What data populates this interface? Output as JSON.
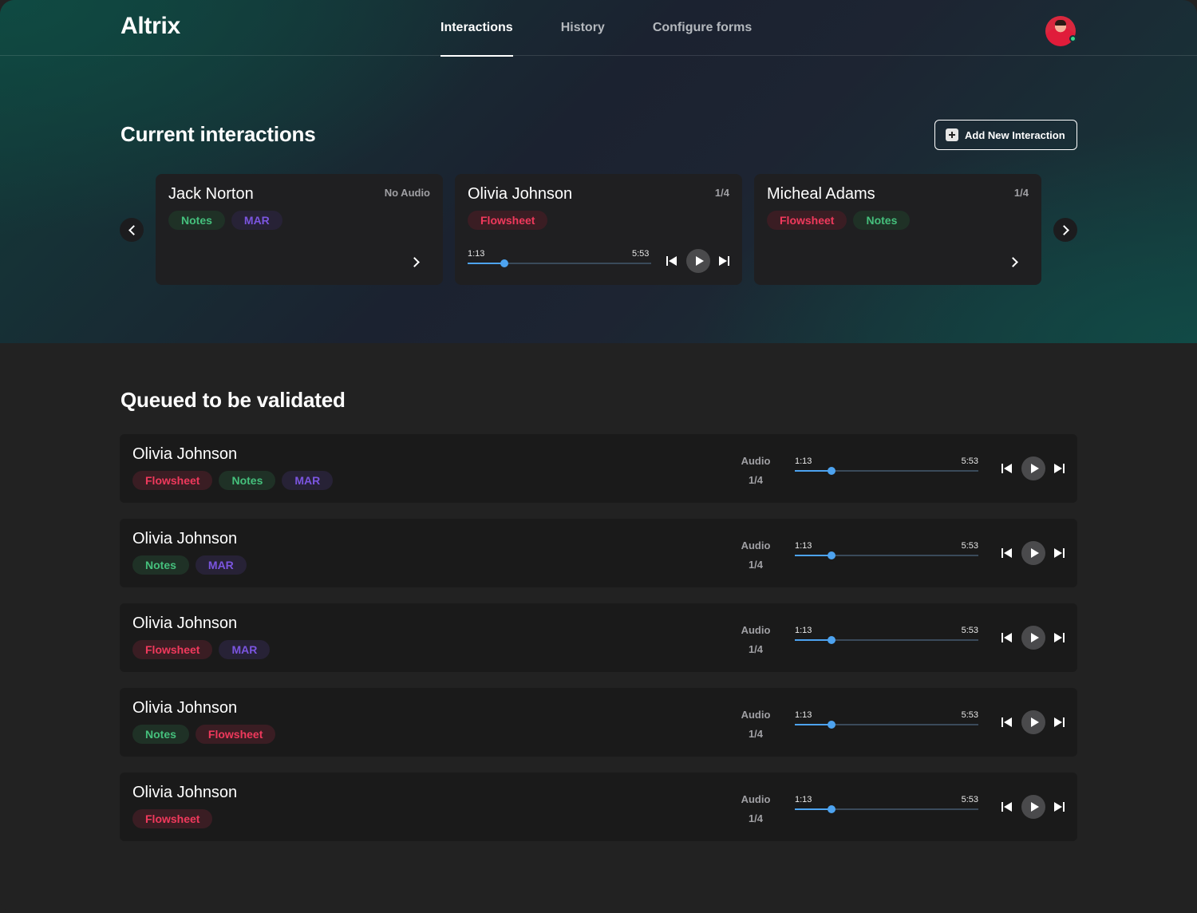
{
  "app": {
    "name": "Altrix"
  },
  "nav": {
    "items": [
      {
        "label": "Interactions",
        "active": true
      },
      {
        "label": "History",
        "active": false
      },
      {
        "label": "Configure forms",
        "active": false
      }
    ]
  },
  "user": {
    "avatar": "avatar",
    "status": "online"
  },
  "current": {
    "title": "Current interactions",
    "add_button": "Add New Interaction",
    "cards": [
      {
        "name": "Jack Norton",
        "meta": "No Audio",
        "tags": [
          "Notes",
          "MAR"
        ],
        "has_player": false
      },
      {
        "name": "Olivia Johnson",
        "meta": "1/4",
        "tags": [
          "Flowsheet"
        ],
        "has_player": true,
        "player": {
          "current": "1:13",
          "total": "5:53",
          "progress": 0.2
        }
      },
      {
        "name": "Micheal Adams",
        "meta": "1/4",
        "tags": [
          "Flowsheet",
          "Notes"
        ],
        "has_player": false
      }
    ]
  },
  "queue": {
    "title": "Queued to be validated",
    "rows": [
      {
        "name": "Olivia Johnson",
        "tags": [
          "Flowsheet",
          "Notes",
          "MAR"
        ],
        "audio_label": "Audio",
        "audio_count": "1/4",
        "current": "1:13",
        "total": "5:53",
        "progress": 0.2
      },
      {
        "name": "Olivia Johnson",
        "tags": [
          "Notes",
          "MAR"
        ],
        "audio_label": "Audio",
        "audio_count": "1/4",
        "current": "1:13",
        "total": "5:53",
        "progress": 0.2
      },
      {
        "name": "Olivia Johnson",
        "tags": [
          "Flowsheet",
          "MAR"
        ],
        "audio_label": "Audio",
        "audio_count": "1/4",
        "current": "1:13",
        "total": "5:53",
        "progress": 0.2
      },
      {
        "name": "Olivia Johnson",
        "tags": [
          "Notes",
          "Flowsheet"
        ],
        "audio_label": "Audio",
        "audio_count": "1/4",
        "current": "1:13",
        "total": "5:53",
        "progress": 0.2
      },
      {
        "name": "Olivia Johnson",
        "tags": [
          "Flowsheet"
        ],
        "audio_label": "Audio",
        "audio_count": "1/4",
        "current": "1:13",
        "total": "5:53",
        "progress": 0.2
      }
    ]
  },
  "colors": {
    "notes": "#45c07c",
    "mar": "#7b55e0",
    "flowsheet": "#f0395c",
    "progress": "#4da3f0"
  }
}
